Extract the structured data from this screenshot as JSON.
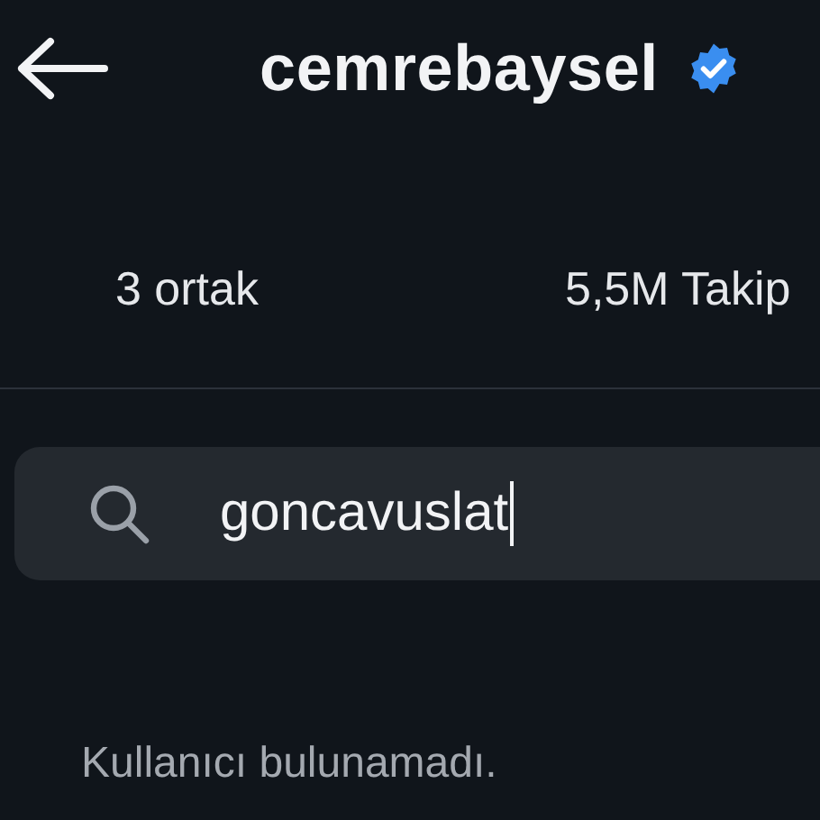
{
  "header": {
    "title": "cemrebaysel",
    "verified": true
  },
  "tabs": [
    {
      "label": "3 ortak"
    },
    {
      "label": "5,5M Takip"
    }
  ],
  "search": {
    "value": "goncavuslat",
    "focused": true
  },
  "message": "Kullanıcı bulunamadı."
}
